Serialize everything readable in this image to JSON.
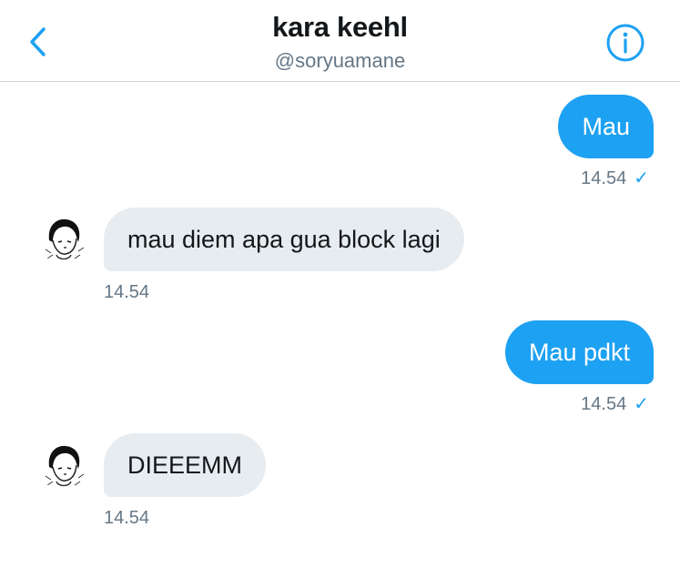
{
  "header": {
    "name": "kara keehl",
    "handle": "@soryuamane",
    "back_icon": "chevron-left-icon",
    "info_icon": "info-circle-icon"
  },
  "colors": {
    "accent": "#1da1f2",
    "received_bubble": "#e6ecf0",
    "meta_text": "#657786"
  },
  "messages": [
    {
      "direction": "sent",
      "text": "Mau",
      "time": "14.54",
      "read_mark": "✓"
    },
    {
      "direction": "received",
      "text": "mau diem apa gua block lagi",
      "time": "14.54"
    },
    {
      "direction": "sent",
      "text": "Mau pdkt",
      "time": "14.54",
      "read_mark": "✓"
    },
    {
      "direction": "received",
      "text": "DIEEEMM",
      "time": "14.54"
    }
  ]
}
